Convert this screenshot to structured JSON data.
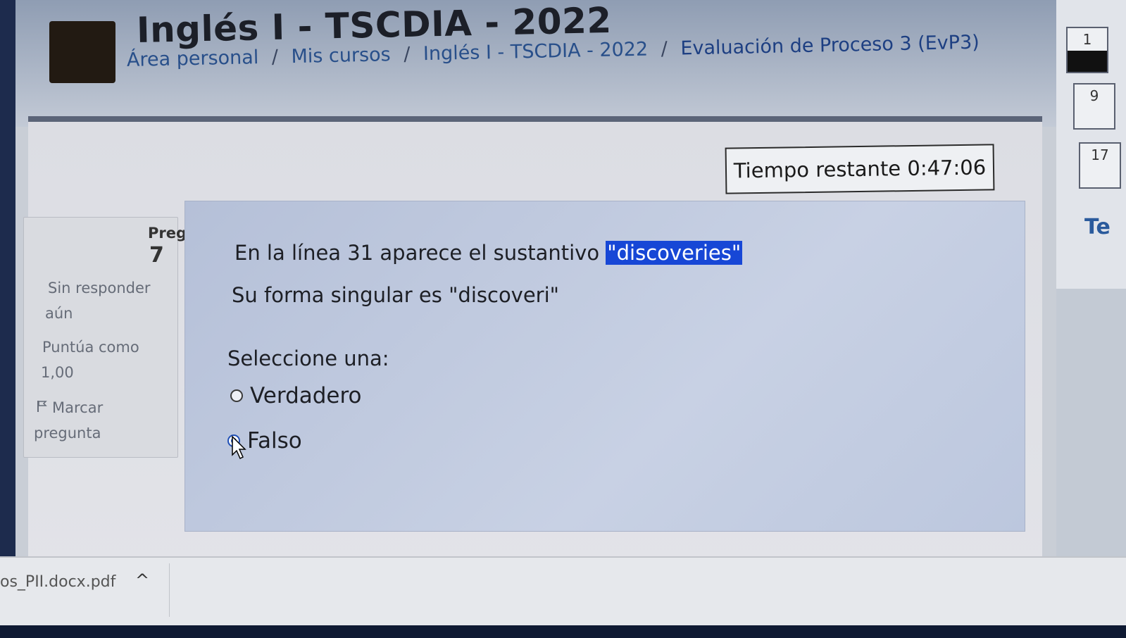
{
  "header": {
    "course_title": "Inglés I - TSCDIA - 2022",
    "breadcrumb": [
      "Área personal",
      "Mis cursos",
      "Inglés I - TSCDIA - 2022",
      "Evaluación de Proceso 3 (EvP3)"
    ],
    "separator": "/"
  },
  "timer": {
    "text": "Tiempo restante 0:47:06"
  },
  "question_info": {
    "label": "Pregun",
    "number": "7",
    "status_line1": "Sin responder",
    "status_line2": "aún",
    "score_line1": "Puntúa como",
    "score_line2": "1,00",
    "flag_line1": "Marcar",
    "flag_line2": "pregunta"
  },
  "question": {
    "line1_prefix": "En la línea 31 aparece el sustantivo ",
    "line1_highlight": "\"discoveries\"",
    "line2": "Su forma singular es \"discoveri\"",
    "prompt": "Seleccione una:",
    "options": [
      {
        "label": "Verdadero",
        "checked": false
      },
      {
        "label": "Falso",
        "checked": true
      }
    ]
  },
  "right_nav": {
    "buttons": [
      "1",
      "9",
      "17"
    ],
    "partial_text": "Te"
  },
  "download_bar": {
    "file_name": "os_PII.docx.pdf",
    "chevron": "^"
  },
  "colors": {
    "highlight": "#1747d6",
    "link": "#284f8a",
    "radio_selected": "#1f4fb6"
  }
}
